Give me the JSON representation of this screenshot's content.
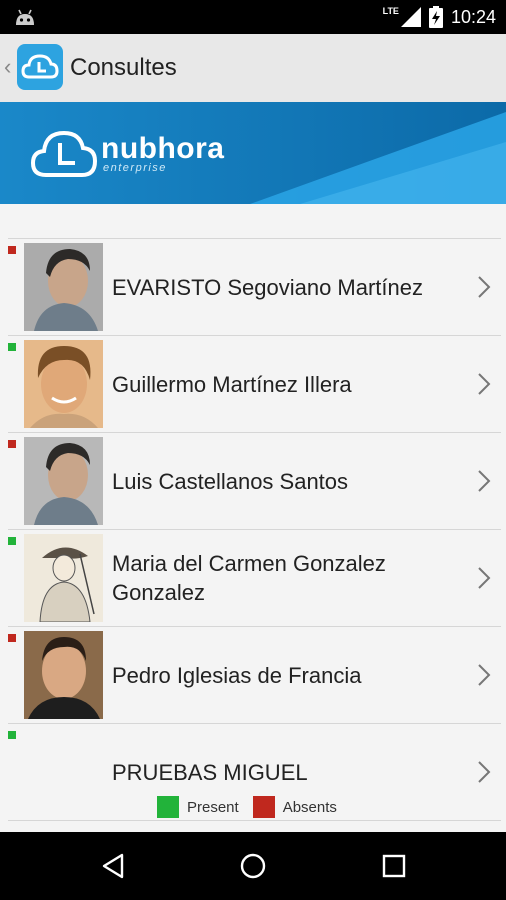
{
  "status_bar": {
    "network": "LTE",
    "time": "10:24"
  },
  "action_bar": {
    "title": "Consultes"
  },
  "banner": {
    "brand": "nubhora",
    "subtitle": "enterprise"
  },
  "colors": {
    "present": "#22b33a",
    "absent": "#c0281e",
    "brand_blue": "#1780c0"
  },
  "employees": [
    {
      "name": "EVARISTO Segoviano Martínez",
      "status": "absent"
    },
    {
      "name": "Guillermo Martínez Illera",
      "status": "present"
    },
    {
      "name": "Luis Castellanos Santos",
      "status": "absent"
    },
    {
      "name": "Maria del Carmen Gonzalez Gonzalez",
      "status": "present"
    },
    {
      "name": "Pedro Iglesias de Francia",
      "status": "absent"
    },
    {
      "name": "PRUEBAS  MIGUEL",
      "status": "present"
    }
  ],
  "legend": {
    "present_label": "Present",
    "absent_label": "Absents"
  },
  "icons": [
    "android-icon",
    "signal-icon",
    "battery-icon",
    "back-arrow-icon",
    "app-logo-icon",
    "chevron-right-icon",
    "nav-back-icon",
    "nav-home-icon",
    "nav-recents-icon"
  ]
}
